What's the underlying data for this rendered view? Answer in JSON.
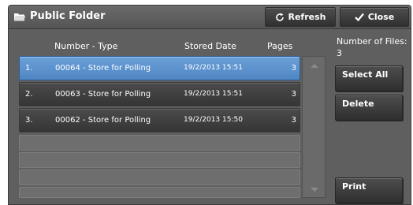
{
  "window": {
    "title": "Public Folder",
    "refresh_label": "Refresh",
    "close_label": "Close"
  },
  "columns": {
    "number_type": "Number - Type",
    "stored_date": "Stored Date",
    "pages": "Pages"
  },
  "files_info": {
    "label": "Number of Files:",
    "count": "3"
  },
  "rows": [
    {
      "index": "1.",
      "name": "00064 - Store for Polling",
      "date": "19/2/2013 15:51",
      "pages": "3",
      "selected": true
    },
    {
      "index": "2.",
      "name": "00063 - Store for Polling",
      "date": "19/2/2013 15:51",
      "pages": "3",
      "selected": false
    },
    {
      "index": "3.",
      "name": "00062 - Store for Polling",
      "date": "19/2/2013 15:50",
      "pages": "3",
      "selected": false
    }
  ],
  "actions": {
    "select_all": "Select All",
    "delete": "Delete",
    "print": "Print"
  },
  "icons": {
    "title": "folder-icon",
    "refresh": "refresh-icon",
    "close": "checkmark-icon",
    "scroll_up": "scroll-up-icon",
    "scroll_down": "scroll-down-icon"
  },
  "colors": {
    "selected_row": "#5b93cf",
    "row": "#404040",
    "panel": "#5f5f5f"
  }
}
